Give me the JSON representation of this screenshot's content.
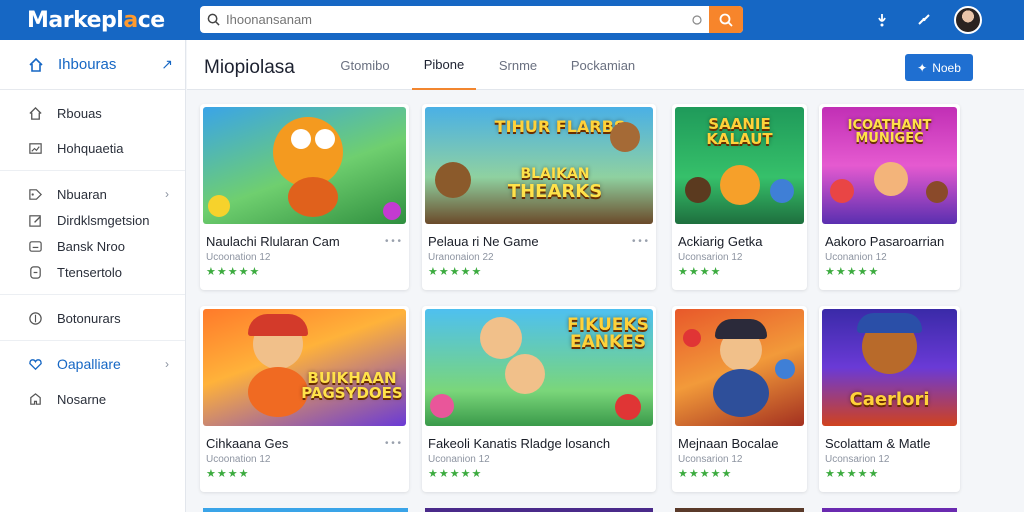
{
  "app": {
    "logo_main": "Markepl",
    "logo_accent": "a",
    "logo_rest": "ce"
  },
  "search": {
    "placeholder": "Ihoonansanam",
    "value": ""
  },
  "sidebar": {
    "header": "Ihbouras",
    "items": [
      {
        "label": "Rbouas",
        "icon": "home-icon"
      },
      {
        "label": "Hohquaetia",
        "icon": "chart-icon"
      },
      {
        "label": "Nbuaran",
        "icon": "tag-icon",
        "chevron": true
      },
      {
        "label": "Dirdklsmgetsion",
        "icon": "edit-icon"
      },
      {
        "label": "Bansk Nroo",
        "icon": "box-icon"
      },
      {
        "label": "Ttensertolo",
        "icon": "doc-icon"
      },
      {
        "label": "Botonurars",
        "icon": "coin-icon"
      },
      {
        "label": "Oapalliare",
        "icon": "heart-icon",
        "chevron": true,
        "active": true
      },
      {
        "label": "Nosarne",
        "icon": "puzzle-icon"
      }
    ]
  },
  "header": {
    "title": "Miopiolasa",
    "tabs": [
      {
        "label": "Gtomibo"
      },
      {
        "label": "Pibone",
        "active": true
      },
      {
        "label": "Srnme"
      },
      {
        "label": "Pockamian"
      }
    ],
    "new_button": "Noeb"
  },
  "cards": [
    {
      "title": "Naulachi Rlularan Cam",
      "sub": "Ucoonation 12",
      "rating": "★★★★★",
      "more": "• • •",
      "banner": ""
    },
    {
      "title": "Pelaua ri Ne Game",
      "sub": "Uranonaion 22",
      "rating": "★★★★★",
      "more": "• • •",
      "banner": "TIHUR FLARBS\nBLAIKAN\nTHEARKS"
    },
    {
      "title": "Ackiarig Getka",
      "sub": "Uconsarion 12",
      "rating": "★★★★",
      "more": "",
      "banner": "SAANIE\nKALAUT"
    },
    {
      "title": "Aakoro Pasaroarrian",
      "sub": "Uconanion 12",
      "rating": "★★★★★",
      "more": "",
      "banner": "ICOATHANT\nMUNIGEC"
    },
    {
      "title": "Cihkaana Ges",
      "sub": "Ucoonation 12",
      "rating": "★★★★",
      "more": "• • •",
      "banner": "BUIKHAAN\nPAGSYDOES"
    },
    {
      "title": "Fakeoli Kanatis Rladge losanch",
      "sub": "Uconanion 12",
      "rating": "★★★★★",
      "more": "",
      "banner": "FIKUEKS\nEANKES"
    },
    {
      "title": "Mejnaan Bocalae",
      "sub": "Uconsarion 12",
      "rating": "★★★★★",
      "more": "",
      "banner": ""
    },
    {
      "title": "Scolattam & Matle",
      "sub": "Uconsarion 12",
      "rating": "★★★★★",
      "more": "",
      "banner": "Caerlori"
    }
  ],
  "colors": {
    "primary": "#1667c4",
    "accent": "#f7852b",
    "star": "#3cab3f"
  }
}
